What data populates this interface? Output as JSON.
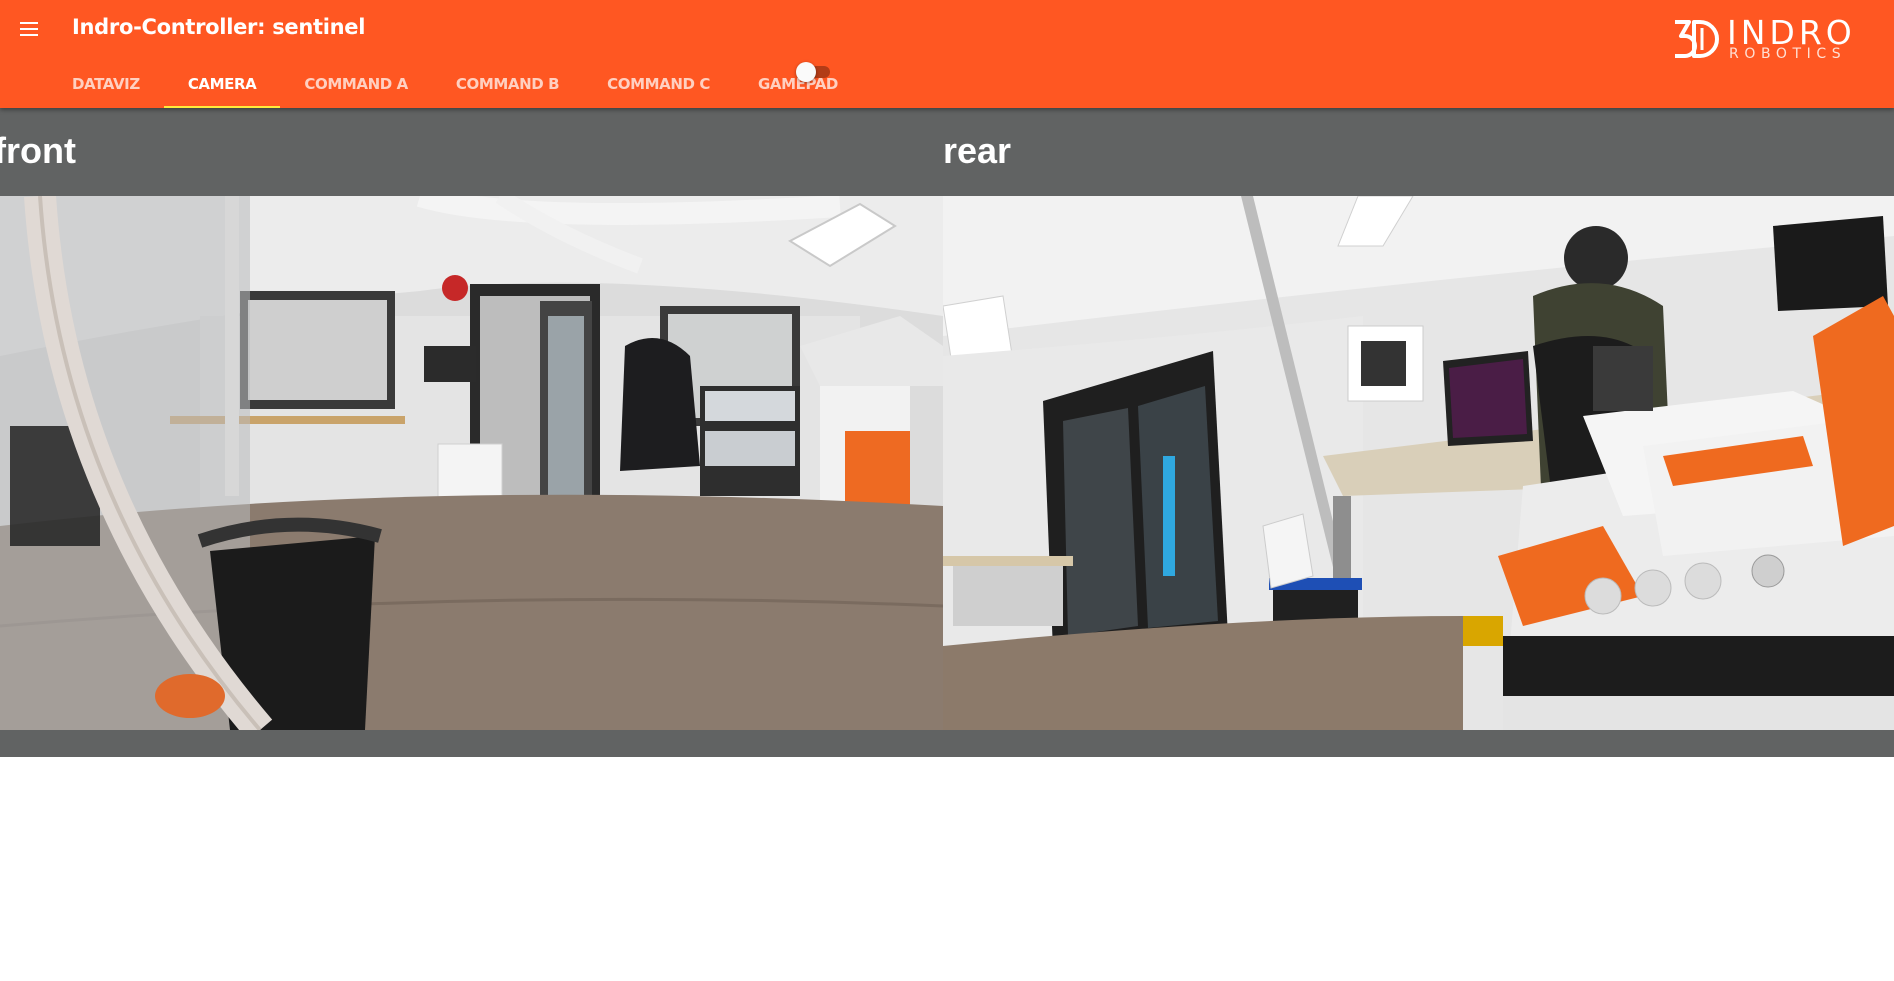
{
  "app": {
    "title": "Indro-Controller: sentinel"
  },
  "tabs": [
    {
      "label": "DATAVIZ",
      "active": false
    },
    {
      "label": "CAMERA",
      "active": true
    },
    {
      "label": "COMMAND A",
      "active": false
    },
    {
      "label": "COMMAND B",
      "active": false
    },
    {
      "label": "COMMAND C",
      "active": false
    },
    {
      "label": "GAMEPAD",
      "active": false
    }
  ],
  "toggle": {
    "state": "off"
  },
  "logo": {
    "word": "INDRO",
    "sub": "ROBOTICS"
  },
  "cameras": [
    {
      "label": "front"
    },
    {
      "label": "rear"
    }
  ],
  "colors": {
    "appbar": "#ff5722",
    "tab_indicator": "#ffeb3b",
    "camera_background": "#616363"
  },
  "icons": {
    "menu": "hamburger-menu-icon"
  }
}
